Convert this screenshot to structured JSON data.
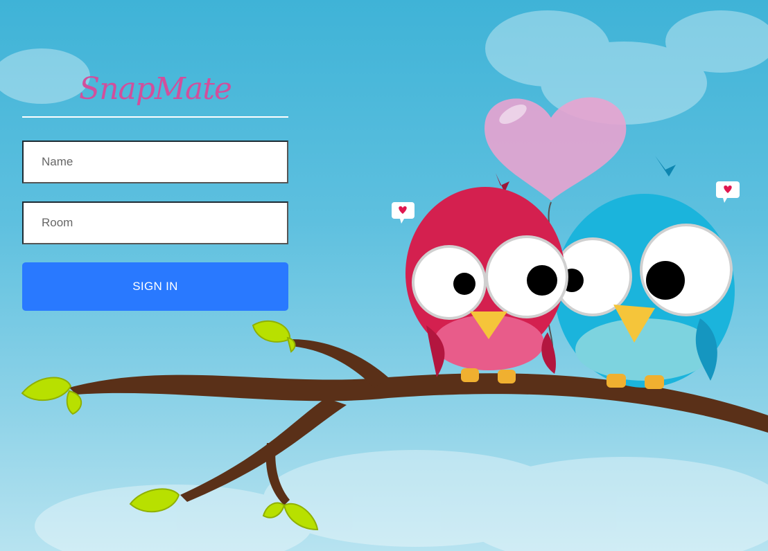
{
  "app": {
    "logo": "SnapMate"
  },
  "form": {
    "name_placeholder": "Name",
    "room_placeholder": "Room",
    "signin_label": "SIGN IN"
  },
  "colors": {
    "background": "#3fb3d7",
    "logo": "#d14f9c",
    "button": "#2979ff",
    "branch": "#5a3018",
    "leaf": "#b8e000",
    "red_bird": "#d4204f",
    "blue_bird": "#1bb4dc",
    "heart_balloon": "#e8a3cf"
  },
  "illustration": {
    "subject": "two-birds-on-branch-with-heart-balloon"
  }
}
